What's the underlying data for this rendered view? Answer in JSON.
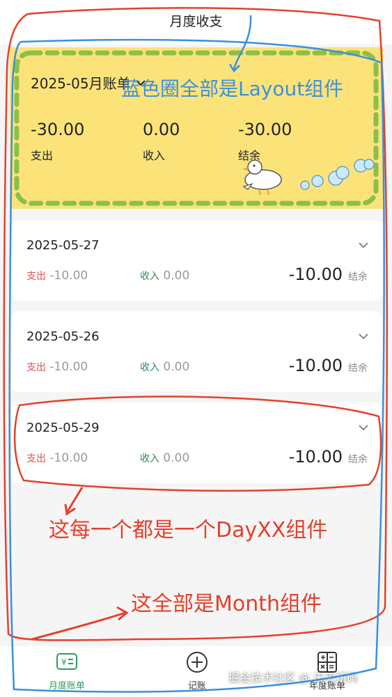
{
  "header": {
    "title": "月度收支"
  },
  "summary": {
    "month_label": "2025-05月账单",
    "stats": [
      {
        "value": "-30.00",
        "label": "支出"
      },
      {
        "value": "0.00",
        "label": "收入"
      },
      {
        "value": "-30.00",
        "label": "结余"
      }
    ]
  },
  "days": [
    {
      "date": "2025-05-27",
      "expense_label": "支出",
      "expense": "-10.00",
      "income_label": "收入",
      "income": "0.00",
      "balance": "-10.00",
      "balance_label": "结余"
    },
    {
      "date": "2025-05-26",
      "expense_label": "支出",
      "expense": "-10.00",
      "income_label": "收入",
      "income": "0.00",
      "balance": "-10.00",
      "balance_label": "结余"
    },
    {
      "date": "2025-05-29",
      "expense_label": "支出",
      "expense": "-10.00",
      "income_label": "收入",
      "income": "0.00",
      "balance": "-10.00",
      "balance_label": "结余"
    }
  ],
  "annotations": {
    "layout": "蓝色圈全部是Layout组件",
    "day": "这每一个都是一个DayXX组件",
    "month": "这全部是Month组件"
  },
  "tabbar": {
    "items": [
      {
        "label": "月度账单",
        "icon": "bill-icon"
      },
      {
        "label": "记账",
        "icon": "plus-circle-icon"
      },
      {
        "label": "年度账单",
        "icon": "calculator-icon"
      }
    ]
  },
  "watermark": "掘金技术社区 @ 天天扭码",
  "colors": {
    "summary_bg": "#fbe37a",
    "expense": "#d9534f",
    "income": "#2e8b57",
    "active_tab": "#2e9b62",
    "annotation_red": "#e4402b",
    "annotation_blue": "#3a8fe0"
  }
}
